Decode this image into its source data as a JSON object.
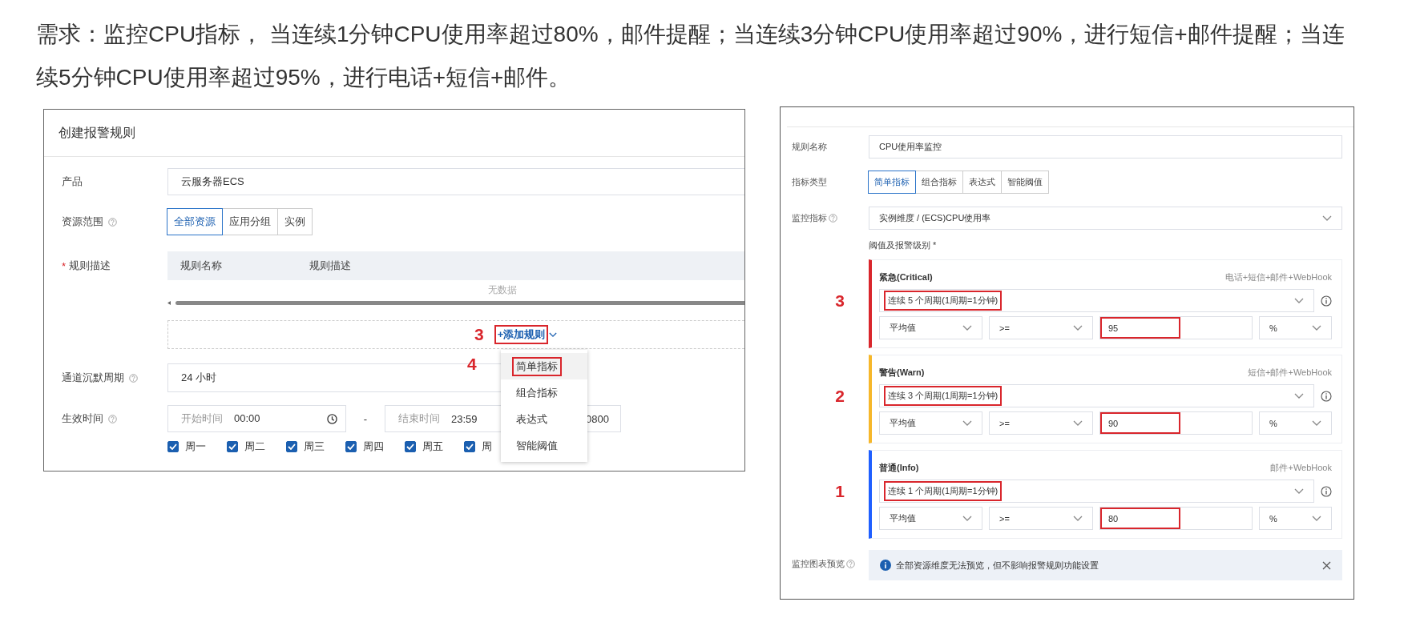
{
  "paragraph": "需求：监控CPU指标， 当连续1分钟CPU使用率超过80%，邮件提醒；当连续3分钟CPU使用率超过90%，进行短信+邮件提醒；当连续5分钟CPU使用率超过95%，进行电话+短信+邮件。",
  "create_rule": {
    "title": "创建报警规则",
    "product": {
      "label": "产品",
      "value": "云服务器ECS"
    },
    "scope": {
      "label": "资源范围",
      "options": [
        {
          "label": "全部资源",
          "selected": true
        },
        {
          "label": "应用分组",
          "selected": false
        },
        {
          "label": "实例",
          "selected": false
        }
      ]
    },
    "rules": {
      "required_mark": "*",
      "label": "规则描述",
      "columns": [
        "规则名称",
        "规则描述"
      ],
      "empty_text": "无数据",
      "step": "3",
      "add_button": "+添加规则",
      "marked": true
    },
    "menu": {
      "step": "4",
      "items": [
        {
          "label": "简单指标",
          "marked": true
        },
        {
          "label": "组合指标",
          "marked": false
        },
        {
          "label": "表达式",
          "marked": false
        },
        {
          "label": "智能阈值",
          "marked": false
        }
      ]
    },
    "silence": {
      "label": "通道沉默周期",
      "value": "24 小时"
    },
    "effective": {
      "label": "生效时间",
      "start_placeholder": "开始时间",
      "start": "00:00",
      "separator": "-",
      "end_placeholder": "结束时间",
      "end": "23:59",
      "timezone": "0800"
    },
    "days": [
      {
        "label": "周一",
        "checked": true
      },
      {
        "label": "周二",
        "checked": true
      },
      {
        "label": "周三",
        "checked": true
      },
      {
        "label": "周四",
        "checked": true
      },
      {
        "label": "周五",
        "checked": true
      },
      {
        "label": "周",
        "checked": true
      }
    ]
  },
  "alarm_form": {
    "name": {
      "label": "规则名称",
      "value": "CPU使用率监控"
    },
    "metric_type": {
      "label": "指标类型",
      "options": [
        {
          "label": "简单指标",
          "selected": true
        },
        {
          "label": "组合指标",
          "selected": false
        },
        {
          "label": "表达式",
          "selected": false
        },
        {
          "label": "智能阈值",
          "selected": false
        }
      ]
    },
    "metric": {
      "label": "监控指标",
      "value": "实例维度 / (ECS)CPU使用率"
    },
    "threshold_label": "阈值及报警级别 *",
    "levels": [
      {
        "step": "3",
        "name": "紧急(Critical)",
        "channels": "电话+短信+邮件+WebHook",
        "color": "#d9262c",
        "condition": "连续 5 个周期(1周期=1分钟)",
        "aggregate": "平均值",
        "operator": ">=",
        "value": "95",
        "unit": "%",
        "marked": true
      },
      {
        "step": "2",
        "name": "警告(Warn)",
        "channels": "短信+邮件+WebHook",
        "color": "#f6b72a",
        "condition": "连续 3 个周期(1周期=1分钟)",
        "aggregate": "平均值",
        "operator": ">=",
        "value": "90",
        "unit": "%",
        "marked": true
      },
      {
        "step": "1",
        "name": "普通(Info)",
        "channels": "邮件+WebHook",
        "color": "#1f5fff",
        "condition": "连续 1 个周期(1周期=1分钟)",
        "aggregate": "平均值",
        "operator": ">=",
        "value": "80",
        "unit": "%",
        "marked": true
      }
    ],
    "preview": {
      "label": "监控图表预览",
      "message": "全部资源维度无法预览，但不影响报警规则功能设置"
    }
  }
}
